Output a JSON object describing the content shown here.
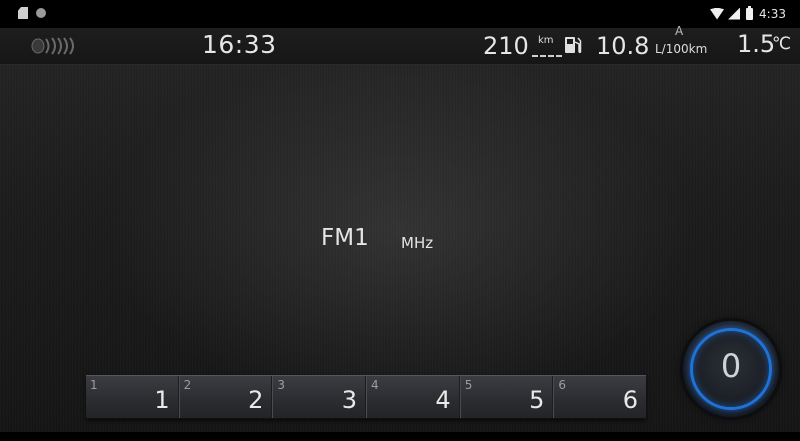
{
  "status_bar": {
    "time": "4:33",
    "icons": [
      "sd-card-icon",
      "dot-icon",
      "wifi-icon",
      "signal-icon",
      "battery-icon"
    ]
  },
  "info_bar": {
    "clock": "16:33",
    "range_value": "210",
    "range_unit": "km",
    "consumption_value": "10.8",
    "consumption_mode": "A",
    "consumption_unit": "L/100km",
    "temperature_value": "1.5",
    "temperature_unit": "℃",
    "icons": [
      "speaker-icon",
      "fuel-pump-icon"
    ]
  },
  "radio": {
    "band": "FM1",
    "frequency_unit": "MHz"
  },
  "presets": [
    {
      "index": "1",
      "label": "1"
    },
    {
      "index": "2",
      "label": "2"
    },
    {
      "index": "3",
      "label": "3"
    },
    {
      "index": "4",
      "label": "4"
    },
    {
      "index": "5",
      "label": "5"
    },
    {
      "index": "6",
      "label": "6"
    }
  ],
  "knob": {
    "value": "0",
    "accent_color": "#1e73d8"
  }
}
